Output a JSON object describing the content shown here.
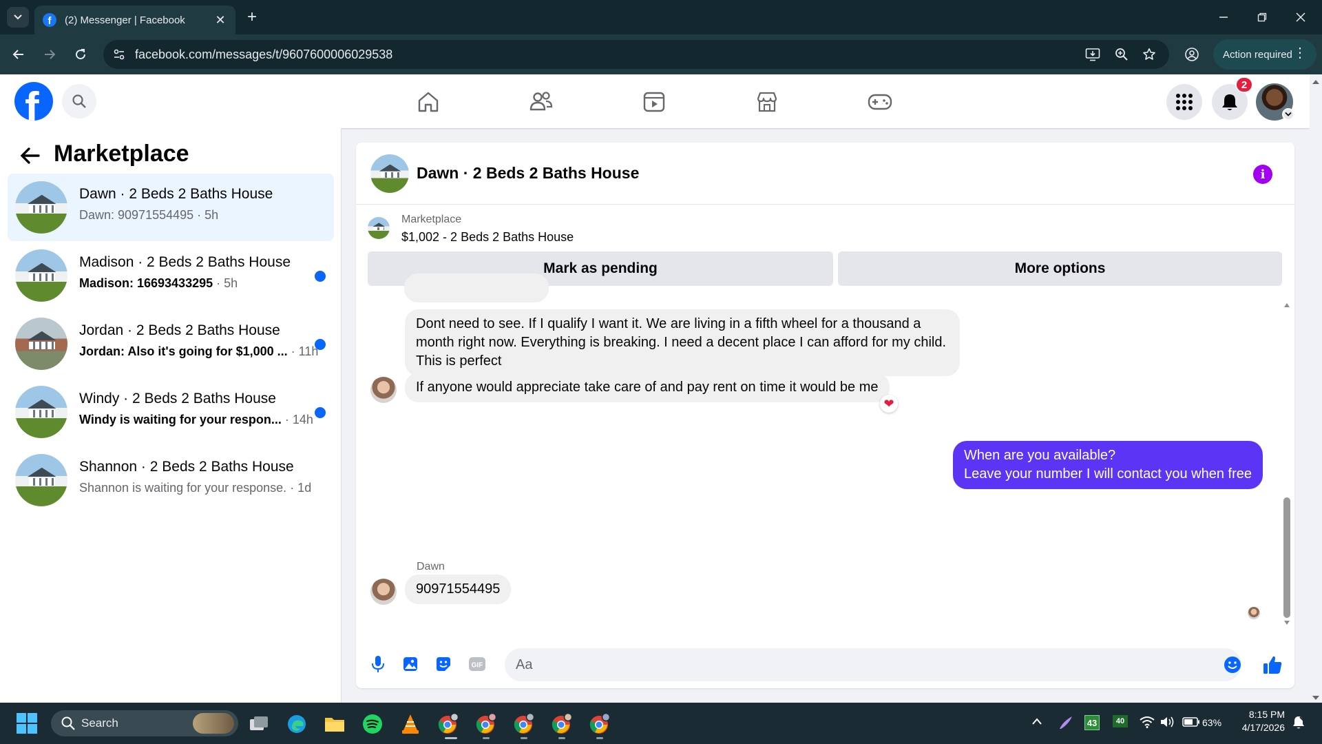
{
  "browser": {
    "tab_title": "(2) Messenger | Facebook",
    "url": "facebook.com/messages/t/9607600006029538",
    "action_required": "Action required"
  },
  "header": {
    "notification_count": "2"
  },
  "sidebar": {
    "title": "Marketplace",
    "conversations": [
      {
        "name": "Dawn · 2 Beds 2 Baths House",
        "preview": "Dawn: 90971554495",
        "time": " · 5h",
        "unread": false,
        "active": true
      },
      {
        "name": "Madison · 2 Beds 2 Baths House",
        "preview": "Madison: 16693433295",
        "time": " · 5h",
        "unread": true,
        "active": false
      },
      {
        "name": "Jordan · 2 Beds 2 Baths House",
        "preview": "Jordan: Also it's going for $1,000 ...",
        "time": " · 11h",
        "unread": true,
        "active": false
      },
      {
        "name": "Windy · 2 Beds 2 Baths House",
        "preview": "Windy is waiting for your respon...",
        "time": " · 14h",
        "unread": true,
        "active": false
      },
      {
        "name": "Shannon · 2 Beds 2 Baths House",
        "preview": "Shannon is waiting for your response.",
        "time": " · 1d",
        "unread": false,
        "active": false
      }
    ]
  },
  "chat": {
    "title": "Dawn · 2 Beds 2 Baths House",
    "listing": {
      "source": "Marketplace",
      "summary": "$1,002 - 2 Beds 2 Baths House",
      "mark_pending": "Mark as pending",
      "more_options": "More options"
    },
    "messages": {
      "m1": "Dont need to see. If I qualify I want it. We are living in a fifth wheel for a thousand a month right now. Everything is breaking. I need a decent place I can afford for my child. This is perfect",
      "m2": "If anyone would appreciate take care of and pay rent on time it would be me",
      "m2_reaction": "❤",
      "m3_line1": "When are you available?",
      "m3_line2": "Leave your number I will contact you when free",
      "sender_label": "Dawn",
      "m4": "90971554495"
    },
    "composer": {
      "placeholder": "Aa"
    }
  },
  "taskbar": {
    "search_label": "Search",
    "battery": "63%",
    "time": "8:15 PM",
    "date": "4/17/2026",
    "tray_badge_1": "43",
    "tray_badge_2": "40"
  },
  "colors": {
    "facebook_blue": "#0866ff",
    "outgoing_bubble": "#5b34f5",
    "info_purple": "#a100f2",
    "unread_dot": "#0866ff",
    "notification_red": "#e41e3f"
  }
}
